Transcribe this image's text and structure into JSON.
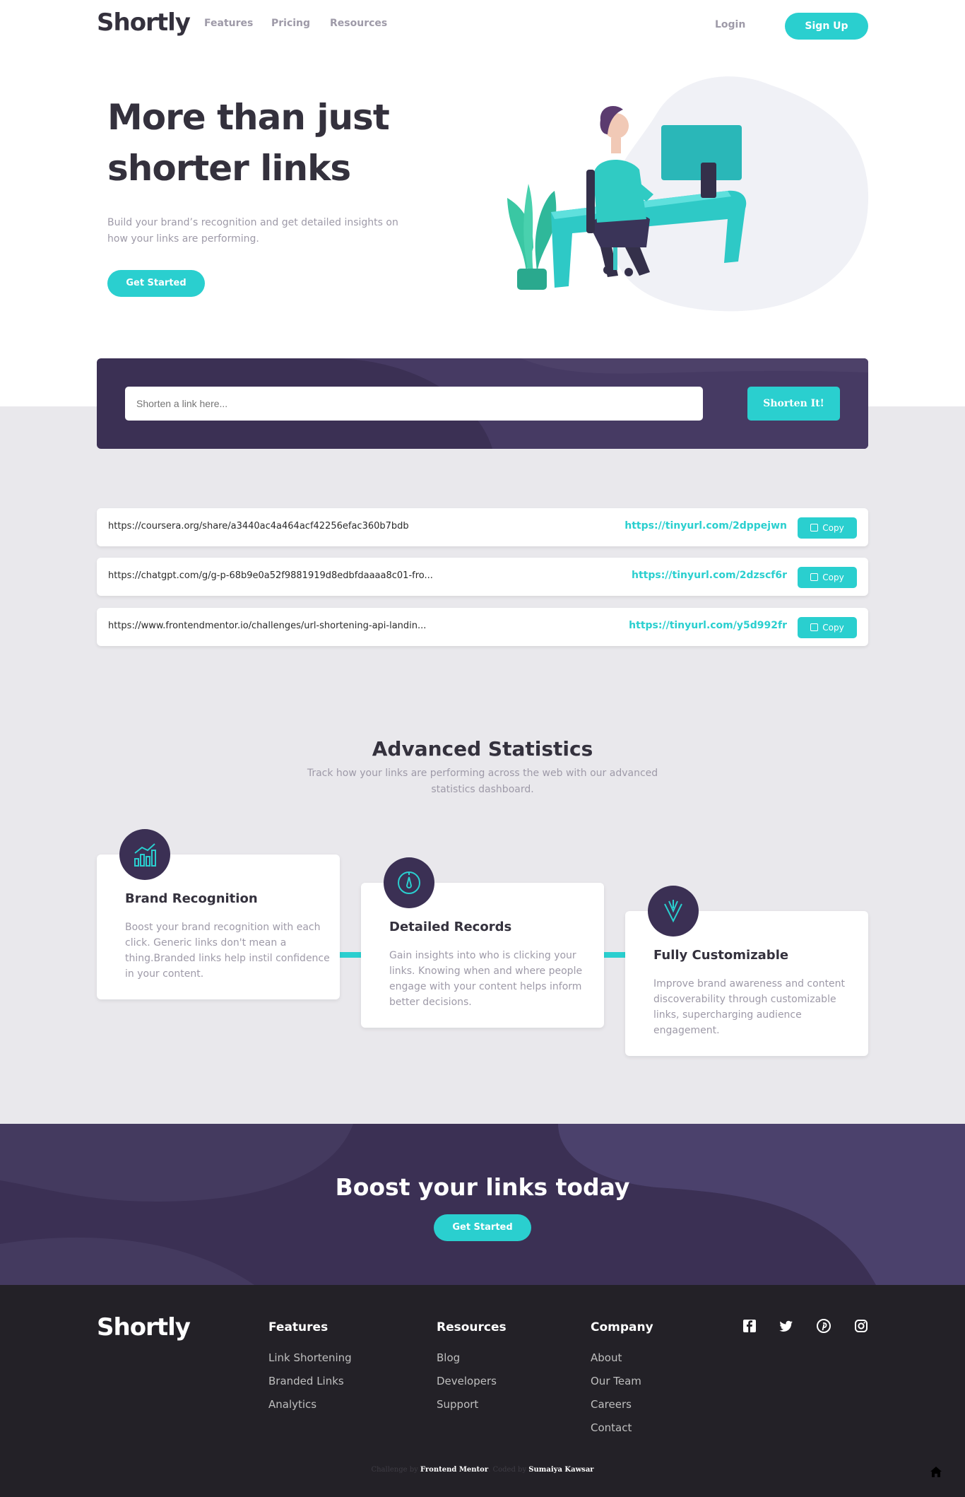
{
  "nav": {
    "logo": "Shortly",
    "links": [
      "Features",
      "Pricing",
      "Resources"
    ],
    "login": "Login",
    "signup": "Sign Up"
  },
  "hero": {
    "title": "More than just shorter links",
    "text": "Build your brand’s recognition and get detailed insights on how your links are performing.",
    "button": "Get Started"
  },
  "shorten": {
    "placeholder": "Shorten a link here...",
    "button": "Shorten It!"
  },
  "results": [
    {
      "original": "https://coursera.org/share/a3440ac4a464acf42256efac360b7bdb",
      "short": "https://tinyurl.com/2dppejwn",
      "copy": "Copy"
    },
    {
      "original": "https://chatgpt.com/g/g-p-68b9e0a52f9881919d8edbfdaaaa8c01-fro...",
      "short": "https://tinyurl.com/2dzscf6r",
      "copy": "Copy"
    },
    {
      "original": "https://www.frontendmentor.io/challenges/url-shortening-api-landin...",
      "short": "https://tinyurl.com/y5d992fr",
      "copy": "Copy"
    }
  ],
  "stats": {
    "title": "Advanced Statistics",
    "subtitle": "Track how your links are performing across the web with our advanced statistics dashboard.",
    "cards": [
      {
        "title": "Brand Recognition",
        "text": "Boost your brand recognition with each click. Generic links don't mean a thing.Branded links help instil confidence in your content.",
        "icon": "bar-chart-icon"
      },
      {
        "title": "Detailed Records",
        "text": "Gain insights into who is clicking your links. Knowing when and where people engage with your content helps inform better decisions.",
        "icon": "gauge-icon"
      },
      {
        "title": "Fully Customizable",
        "text": "Improve brand awareness and content discoverability through customizable links, supercharging audience engagement.",
        "icon": "brushes-icon"
      }
    ]
  },
  "boost": {
    "title": "Boost your links today",
    "button": "Get Started"
  },
  "footer": {
    "logo": "Shortly",
    "columns": [
      {
        "title": "Features",
        "links": [
          "Link Shortening",
          "Branded Links",
          "Analytics"
        ]
      },
      {
        "title": "Resources",
        "links": [
          "Blog",
          "Developers",
          "Support"
        ]
      },
      {
        "title": "Company",
        "links": [
          "About",
          "Our Team",
          "Careers",
          "Contact"
        ]
      }
    ],
    "social": [
      "facebook-icon",
      "twitter-icon",
      "pinterest-icon",
      "instagram-icon"
    ],
    "credit": {
      "prefix": "Challenge by",
      "mentor": "Frontend Mentor",
      "coded": ". Coded by",
      "author": "Sumaiya Kawsar"
    }
  },
  "colors": {
    "cyan": "#2acfcf",
    "violet": "#3b3054",
    "gray_bg": "#e9e8ec",
    "footer_bg": "#232127"
  }
}
